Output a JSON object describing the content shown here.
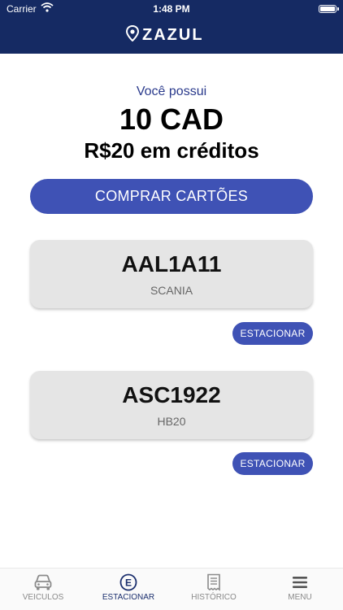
{
  "status_bar": {
    "carrier": "Carrier",
    "time": "1:48 PM"
  },
  "brand": {
    "name": "ZAZUL"
  },
  "credits": {
    "intro": "Você possui",
    "cad": "10 CAD",
    "brl": "R$20 em créditos"
  },
  "buy_button": {
    "label": "COMPRAR CARTÕES"
  },
  "vehicles": [
    {
      "plate": "AAL1A11",
      "model": "SCANIA",
      "action": "ESTACIONAR"
    },
    {
      "plate": "ASC1922",
      "model": "HB20",
      "action": "ESTACIONAR"
    }
  ],
  "tabbar": {
    "tabs": [
      {
        "label": "VEICULOS",
        "icon": "car-icon",
        "active": false
      },
      {
        "label": "ESTACIONAR",
        "icon": "parking-icon",
        "active": true
      },
      {
        "label": "HISTÓRICO",
        "icon": "receipt-icon",
        "active": false
      },
      {
        "label": "MENU",
        "icon": "hamburger-menu-icon",
        "active": false
      }
    ]
  },
  "colors": {
    "header": "#152a63",
    "accent": "#3f52b5",
    "card": "#e5e5e5"
  }
}
